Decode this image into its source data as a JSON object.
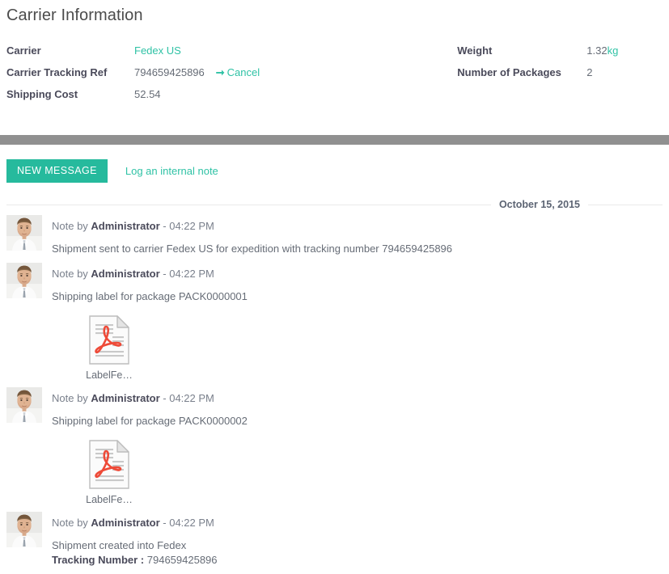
{
  "page": {
    "title": "Carrier Information"
  },
  "carrier_form": {
    "left_fields": [
      {
        "label": "Carrier",
        "value": "Fedex US",
        "style": "link"
      },
      {
        "label": "Carrier Tracking Ref",
        "value": "794659425896",
        "style": "text"
      },
      {
        "label": "Shipping Cost",
        "value": "52.54",
        "style": "text"
      }
    ],
    "right_fields": [
      {
        "label": "Weight",
        "value": "1.32",
        "unit": "kg"
      },
      {
        "label": "Number of Packages",
        "value": "2",
        "unit": ""
      }
    ],
    "cancel": {
      "arrow_icon": "arrow-right-icon",
      "label": "Cancel"
    }
  },
  "composer": {
    "new_message_label": "NEW MESSAGE",
    "internal_note_label": "Log an internal note",
    "accent_color": "#26ba9d",
    "link_color": "#2fc2a5"
  },
  "thread": {
    "date_divider": "October 15, 2015",
    "messages": [
      {
        "avatar": "user-avatar",
        "prefix": "Note by",
        "author": "Administrator",
        "time": "- 04:22 PM",
        "text": "Shipment sent to carrier Fedex US for expedition with tracking number 794659425896",
        "attachment": null
      },
      {
        "avatar": "user-avatar",
        "prefix": "Note by",
        "author": "Administrator",
        "time": "- 04:22 PM",
        "text": "Shipping label for package PACK0000001",
        "attachment": {
          "icon": "pdf-file-icon",
          "filename": "LabelFe…"
        }
      },
      {
        "avatar": "user-avatar",
        "prefix": "Note by",
        "author": "Administrator",
        "time": "- 04:22 PM",
        "text": "Shipping label for package PACK0000002",
        "attachment": {
          "icon": "pdf-file-icon",
          "filename": "LabelFe…"
        }
      },
      {
        "avatar": "user-avatar",
        "prefix": "Note by",
        "author": "Administrator",
        "time": "- 04:22 PM",
        "text": "Shipment created into Fedex",
        "text_line2_bold": "Tracking Number :",
        "text_line2_rest": " 794659425896",
        "attachment": null
      }
    ]
  }
}
